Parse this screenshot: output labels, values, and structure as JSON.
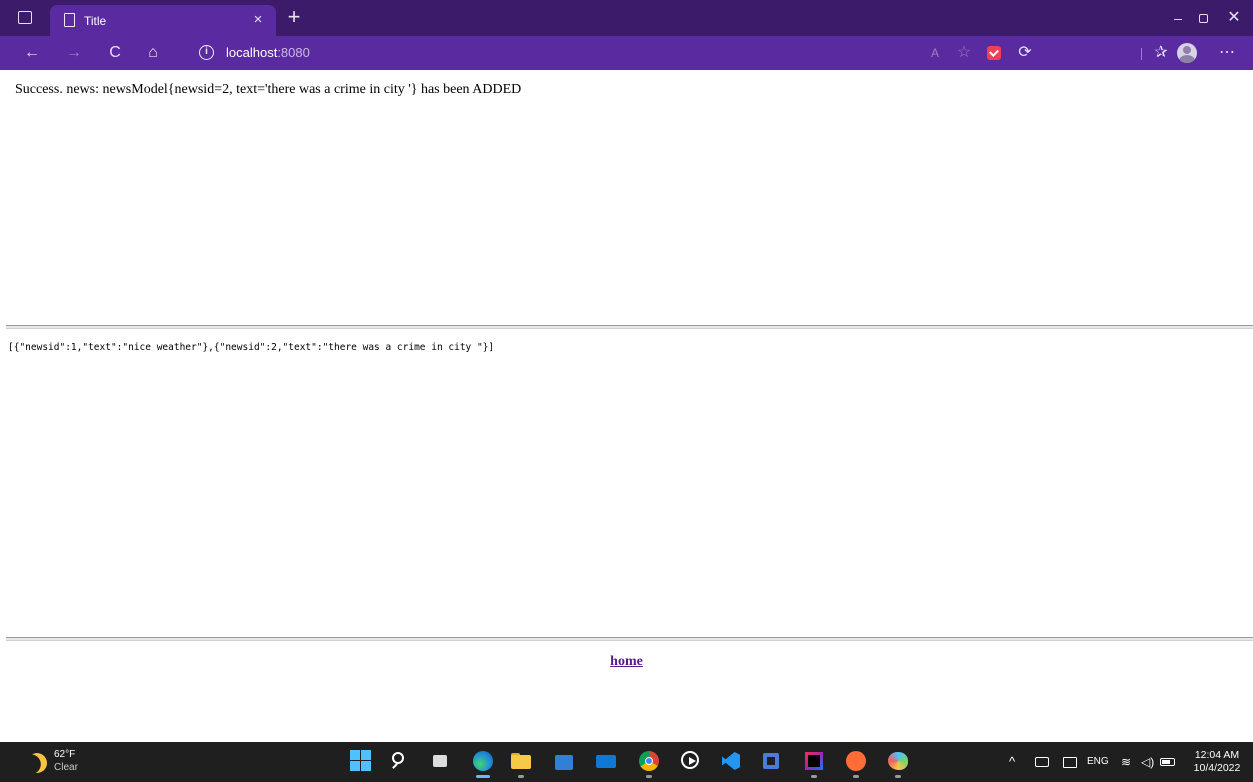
{
  "browser": {
    "tab_title": "Title",
    "tab_close": "×",
    "new_tab": "+",
    "url_host": "localhost",
    "url_port": ":8080",
    "window_controls": {
      "minimize": "–",
      "close": "✕"
    },
    "toolbar_icons": {
      "back": "←",
      "forward": "→",
      "refresh": "C",
      "home": "⌂",
      "read_aloud": "A",
      "favorite": "☆",
      "extensions": "⟳",
      "favorites_list": "✰",
      "collections": "⧉",
      "more": "⋯"
    },
    "colors": {
      "tab_strip": "#3d1b6b",
      "toolbar": "#5a2aa0",
      "visited_link": "#551a8b"
    }
  },
  "page": {
    "message": "Success. news: newsModel{newsid=2, text='there was a crime in city '} has been ADDED",
    "json_response": "[{\"newsid\":1,\"text\":\"nice weather\"},{\"newsid\":2,\"text\":\"there was a crime in city \"}]",
    "home_link": "home"
  },
  "taskbar": {
    "weather_temp": "62°F",
    "weather_desc": "Clear",
    "language": "ENG",
    "tray_chevron": "^",
    "wifi": "≋",
    "volume": "◁)",
    "time": "12:04 AM",
    "date": "10/4/2022",
    "apps": [
      "start-icon",
      "search-icon",
      "task-view-icon",
      "edge-icon",
      "file-explorer-icon",
      "store-icon",
      "mail-icon",
      "chrome-icon",
      "media-player-icon",
      "vscode-icon",
      "sublime-icon",
      "intellij-icon",
      "postman-icon",
      "paint-icon"
    ]
  }
}
